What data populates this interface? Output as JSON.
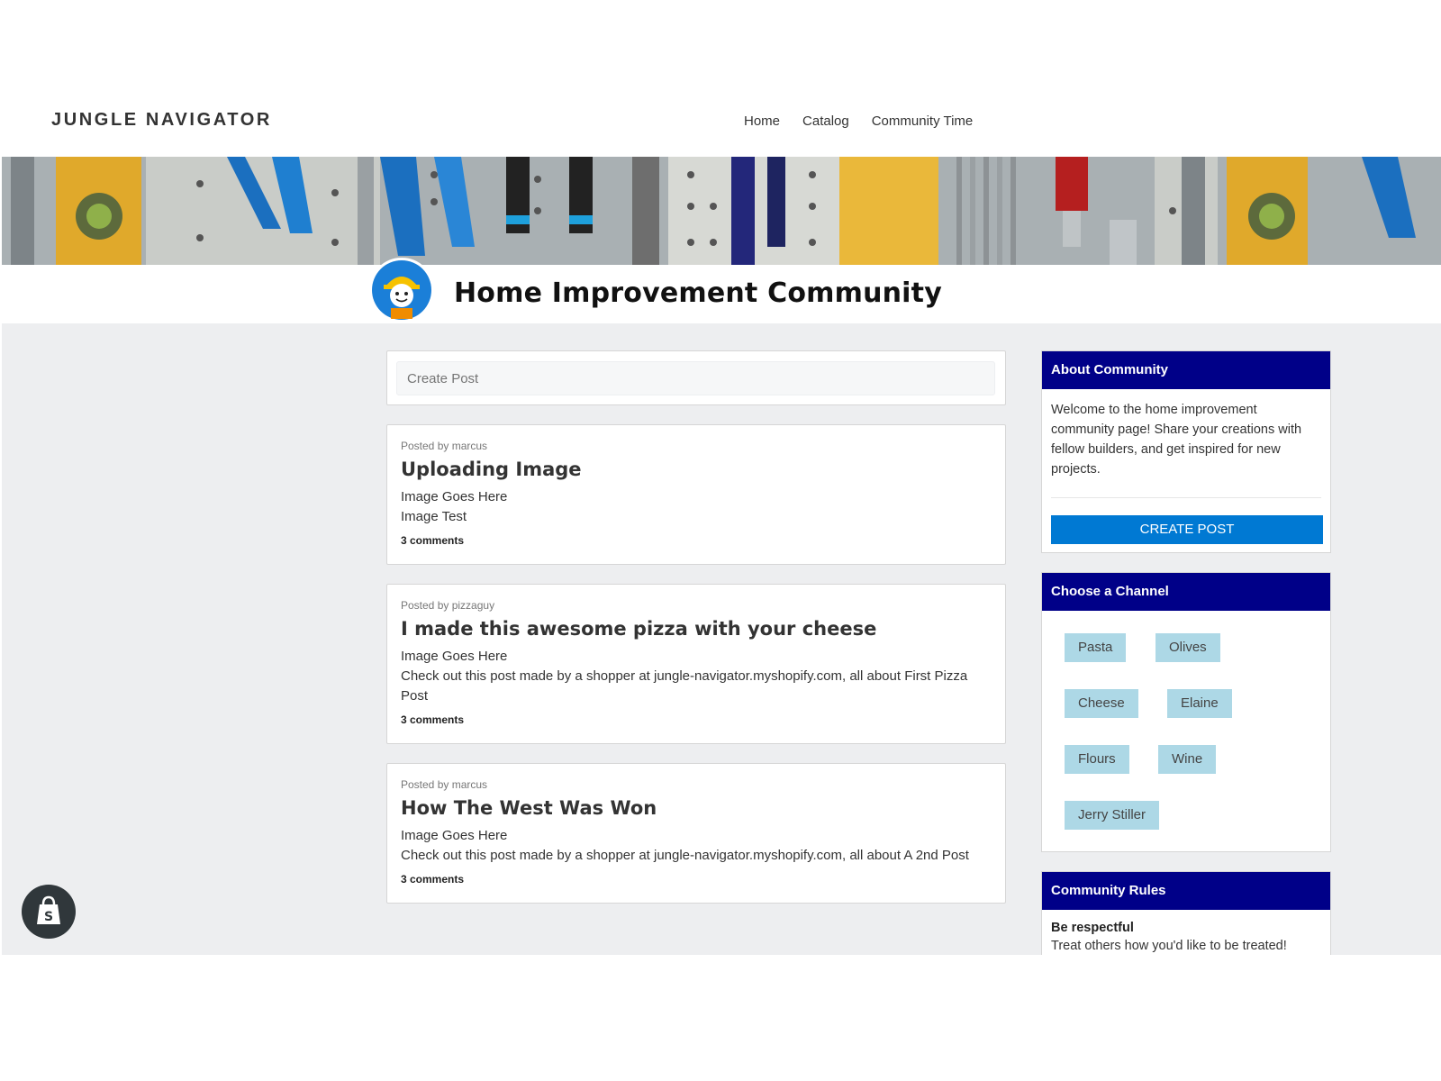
{
  "header": {
    "brand": "JUNGLE NAVIGATOR",
    "nav": [
      "Home",
      "Catalog",
      "Community Time"
    ]
  },
  "community": {
    "title": "Home Improvement Community"
  },
  "create_post": {
    "placeholder": "Create Post"
  },
  "posts": [
    {
      "meta": "Posted by marcus",
      "title": "Uploading Image",
      "body_lines": [
        "Image Goes Here",
        "Image Test"
      ],
      "comments": "3 comments"
    },
    {
      "meta": "Posted by pizzaguy",
      "title": "I made this awesome pizza with your cheese",
      "body_lines": [
        "Image Goes Here",
        "Check out this post made by a shopper at jungle-navigator.myshopify.com, all about First Pizza Post"
      ],
      "comments": "3 comments"
    },
    {
      "meta": "Posted by marcus",
      "title": "How The West Was Won",
      "body_lines": [
        "Image Goes Here",
        "Check out this post made by a shopper at jungle-navigator.myshopify.com, all about A 2nd Post"
      ],
      "comments": "3 comments"
    }
  ],
  "sidebar": {
    "about": {
      "heading": "About Community",
      "text": "Welcome to the home improvement community page! Share your creations with fellow builders, and get inspired for new projects.",
      "button": "CREATE POST"
    },
    "channels": {
      "heading": "Choose a Channel",
      "items": [
        "Pasta",
        "Olives",
        "Cheese",
        "Elaine",
        "Flours",
        "Wine",
        "Jerry Stiller"
      ]
    },
    "rules": {
      "heading": "Community Rules",
      "rule_title": "Be respectful",
      "rule_text": "Treat others how you'd like to be treated!"
    }
  },
  "colors": {
    "sidebar_header": "#000088",
    "primary_button": "#0079d3",
    "chip": "#add8e6",
    "page_bg": "#edeef0"
  },
  "icons": {
    "avatar": "builder-mascot-icon",
    "shop_badge": "shopify-bag-icon"
  }
}
